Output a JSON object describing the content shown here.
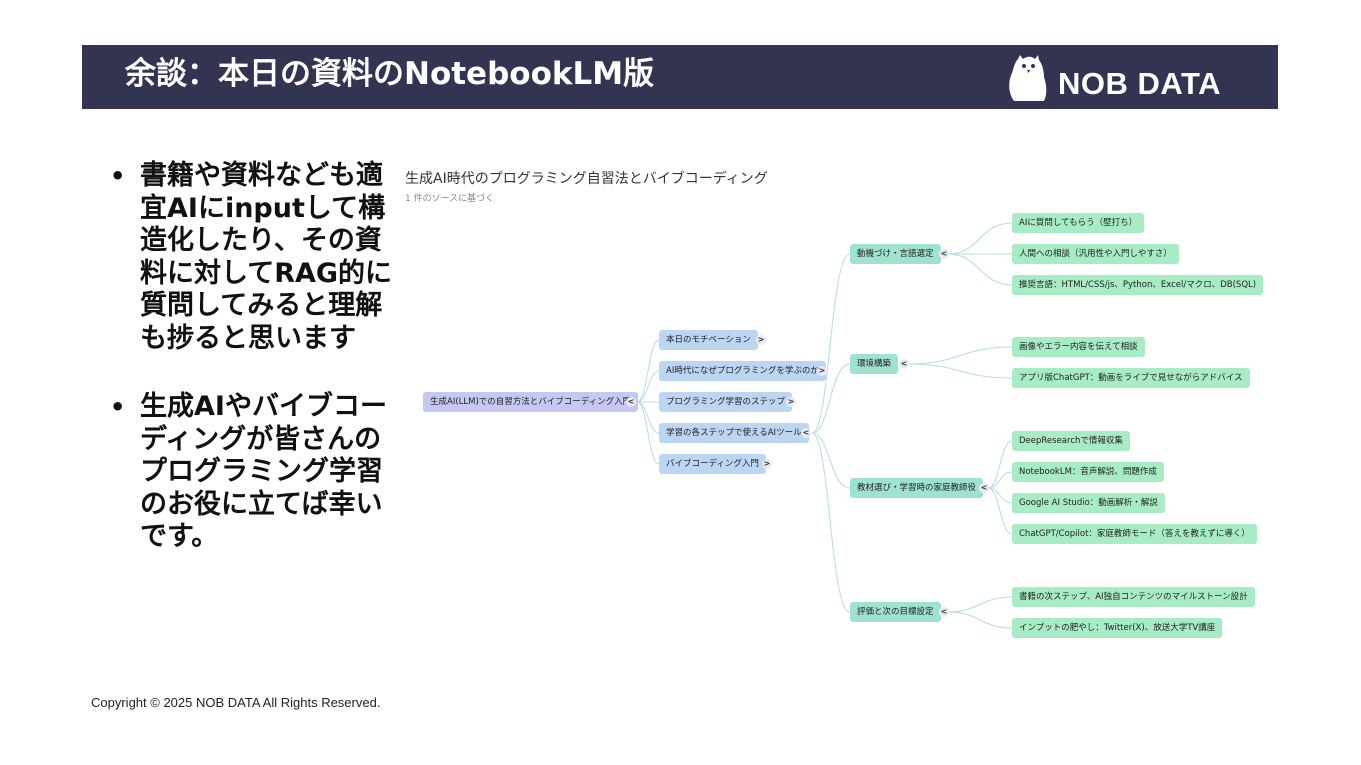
{
  "header": {
    "title": "余談：本日の資料のNotebookLM版",
    "logo_text": "NOB DATA"
  },
  "bullets": [
    "書籍や資料なども適宜AIにinputして構造化したり、その資料に対してRAG的に質問してみると理解も捗ると思います",
    "生成AIやバイブコーディングが皆さんのプログラミング学習のお役に立てば幸いです。"
  ],
  "mindmap": {
    "title": "生成AI時代のプログラミング自習法とバイブコーディング",
    "subtitle": "1 件のソースに基づく",
    "root": "生成AI(LLM)での自習方法とバイブコーディング入門",
    "level1": [
      "本日のモチベーション",
      "AI時代になぜプログラミングを学ぶのか",
      "プログラミング学習のステップ",
      "学習の各ステップで使えるAIツール",
      "バイブコーディング入門"
    ],
    "level2": [
      "動機づけ・言語選定",
      "環境構築",
      "教材選び・学習時の家庭教師役",
      "評価と次の目標設定"
    ],
    "level3": [
      "AIに質問してもらう（壁打ち）",
      "人間への相談（汎用性や入門しやすさ）",
      "推奨言語：HTML/CSS/js、Python、Excel/マクロ、DB(SQL)",
      "画像やエラー内容を伝えて相談",
      "アプリ版ChatGPT：動画をライブで見せながらアドバイス",
      "DeepResearchで情報収集",
      "NotebookLM：音声解説、問題作成",
      "Google AI Studio：動画解析・解説",
      "ChatGPT/Copilot：家庭教師モード（答えを教えずに導く）",
      "書籍の次ステップ、AI独自コンテンツのマイルストーン設計",
      "インプットの肥やし：Twitter(X)、放送大学TV講座"
    ],
    "toggle_expanded": "<",
    "toggle_collapsed": ">"
  },
  "footer": {
    "copyright": "Copyright © 2025 NOB DATA All Rights Reserved."
  },
  "colors": {
    "header_bg": "#323452",
    "root_node": "#c5c8f2",
    "level1_node": "#bcd5f3",
    "level2_node": "#9fe2cf",
    "level3_node": "#a7ecc4",
    "connector": "#b5dbe4"
  }
}
